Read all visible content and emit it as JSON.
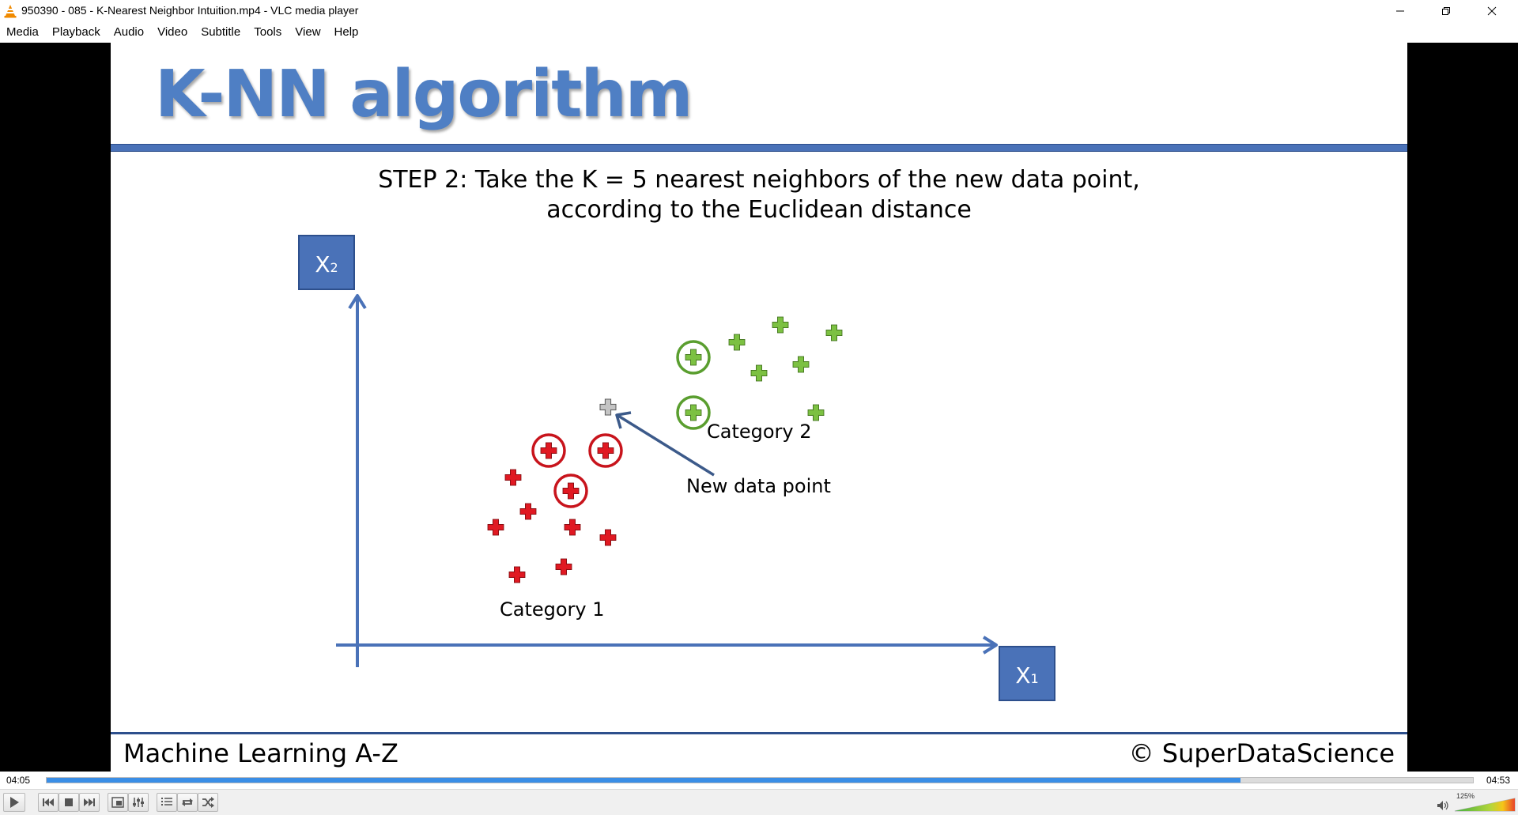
{
  "window": {
    "title": "950390 - 085 - K-Nearest Neighbor Intuition.mp4 - VLC media player",
    "icons": [
      "vlc-cone-icon",
      "minimize-icon",
      "maximize-icon",
      "close-icon"
    ]
  },
  "menu": {
    "items": [
      "Media",
      "Playback",
      "Audio",
      "Video",
      "Subtitle",
      "Tools",
      "View",
      "Help"
    ]
  },
  "slide": {
    "title": "K-NN algorithm",
    "step_label": "STEP 2:",
    "step_line1_rest": " Take the K = 5 nearest neighbors of the new data point,",
    "step_line2": "according to the Euclidean distance",
    "axis_y_label_main": "X",
    "axis_y_label_sub": "2",
    "axis_x_label_main": "X",
    "axis_x_label_sub": "1",
    "category1_label": "Category 1",
    "category2_label": "Category 2",
    "new_point_label": "New data point",
    "footer_left": "Machine Learning A-Z",
    "footer_right": "© SuperDataScience",
    "colors": {
      "accent_blue": "#4a72b8",
      "category1_red": "#e01922",
      "category2_green": "#7cc142",
      "new_point_grey": "#9a9a9a"
    }
  },
  "player": {
    "time_elapsed": "04:05",
    "time_total": "04:53",
    "progress": 0.837,
    "volume_label": "125%",
    "volume_level": 1.25,
    "buttons": [
      "play-icon",
      "previous-icon",
      "stop-icon",
      "next-icon",
      "fullscreen-icon",
      "extended-settings-icon",
      "playlist-icon",
      "loop-icon",
      "shuffle-icon",
      "speaker-icon"
    ]
  }
}
